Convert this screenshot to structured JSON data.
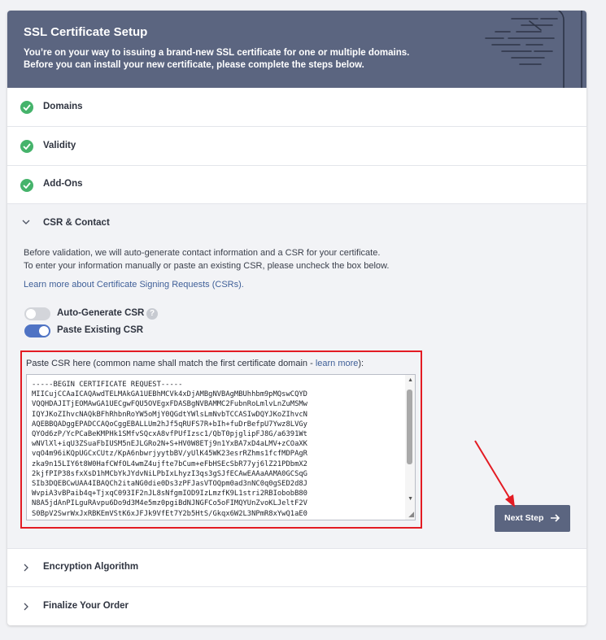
{
  "header": {
    "title": "SSL Certificate Setup",
    "line1": "You’re on your way to issuing a brand-new SSL certificate for one or multiple domains.",
    "line2": "Before you can install your new certificate, please complete the steps below."
  },
  "steps": [
    {
      "label": "Domains",
      "status": "complete"
    },
    {
      "label": "Validity",
      "status": "complete"
    },
    {
      "label": "Add-Ons",
      "status": "complete"
    },
    {
      "label": "CSR & Contact",
      "status": "expanded"
    },
    {
      "label": "Encryption Algorithm",
      "status": "collapsed"
    },
    {
      "label": "Finalize Your Order",
      "status": "collapsed"
    }
  ],
  "csr": {
    "desc1": "Before validation, we will auto-generate contact information and a CSR for your certificate.",
    "desc2": "To enter your information manually or paste an existing CSR, please uncheck the box below.",
    "learn_link": "Learn more about Certificate Signing Requests (CSRs).",
    "auto_generate": {
      "label": "Auto-Generate CSR",
      "on": false
    },
    "paste_existing": {
      "label": "Paste Existing CSR",
      "on": true
    },
    "help_icon": "?",
    "paste_label_prefix": "Paste CSR here (common name shall match the first certificate domain - ",
    "paste_label_link": "learn more",
    "paste_label_suffix": "):",
    "textarea_lines": [
      "-----BEGIN CERTIFICATE REQUEST-----",
      "MIICujCCAaICAQAwdTELMAkGA1UEBhMCVk4xDjAMBgNVBAgMBUhhbm9pMQswCQYD",
      "VQQHDAJITjEOMAwGA1UECgwFQU5OVEgxFDASBgNVBAMMC2FubnRoLmlvLnZuMSMw",
      "IQYJKoZIhvcNAQkBFhRhbnRoYW5oMjY0QGdtYWlsLmNvbTCCASIwDQYJKoZIhvcN",
      "AQEBBQADggEPADCCAQoCggEBALLUm2hJf5qRUFS7R+bIh+fuDrBefpU7Ywz8LVGy",
      "QYOd6zP/YcPCaBeKMPHk1SMfvSQcxA8vfPUfIzsc1/QbT0pjglipFJ8G/a6391Wt",
      "wNVlXl+iqU3ZSuaFbIUSM5nEJLGRo2N+S+HV0W8ETj9n1YxBA7xD4aLMV+zCOaXK",
      "vqO4m96iKQpUGCxCUtz/KpA6nbwrjyytbBV/yUlK45WK23esrRZhms1fcfMDPAgR",
      "zka9n15LIY6t8W0HafCWfOL4wmZ4ujfte7bCum+eFbHSEcSbR77yj6lZ21PDbmX2",
      "2kjfPIP38sfxXsD1hMCbYkJYdvNiLPbIxLhyzI3qs3gSJfECAwEAAaAAMA0GCSqG",
      "SIb3DQEBCwUAA4IBAQCh2itaNG0die0Ds3zPFJasVTOQpm0ad3nNC0q0gSED2d8J",
      "WvpiA3vBPaib4q+TjxqC093IF2nJL8sNfgmIOD9IzLmzfK9L1stri2RBIobobB80",
      "N8A5jdAnPILguRAvpu6Do9d3M4e5mz0pgiBdNJNGFCo5oFIMQYUnZvoKLJeltF2V",
      "S0BpV2SwrWxJxRBKEmVStK6xJFJk9VfEt7Y2b5HtS/Gkqx6W2L3NPmR8xYwQ1aE0"
    ],
    "next_button": "Next Step"
  },
  "colors": {
    "header_bg": "#5b6580",
    "check_green": "#45b36b",
    "toggle_on": "#4f73c4",
    "toggle_off": "#d3d5da",
    "highlight_red": "#e31b23",
    "link_blue": "#3f5f98"
  },
  "icons": {
    "step_complete": "check-circle-icon",
    "step_expanded": "chevron-down-icon",
    "step_collapsed": "chevron-right-icon",
    "next": "arrow-right-icon"
  }
}
